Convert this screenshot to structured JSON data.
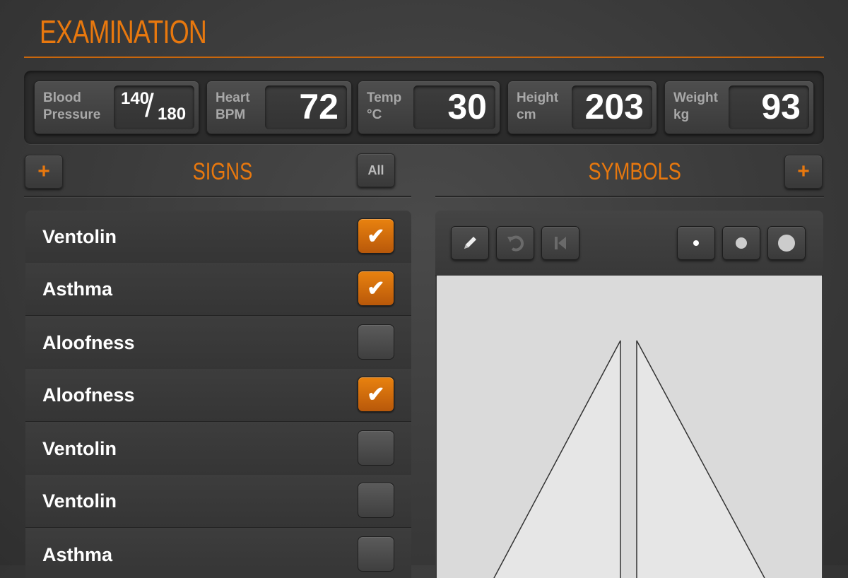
{
  "app": {
    "title": "EXAMINATION"
  },
  "vitals": {
    "blood_pressure": {
      "label": "Blood\nPressure",
      "systolic": "140",
      "separator": "/",
      "diastolic": "180"
    },
    "heart": {
      "label": "Heart\nBPM",
      "value": "72"
    },
    "temp": {
      "label": "Temp\n°C",
      "value": "30"
    },
    "height": {
      "label": "Height\ncm",
      "value": "203"
    },
    "weight": {
      "label": "Weight\nkg",
      "value": "93"
    }
  },
  "signs": {
    "title": "SIGNS",
    "add_label": "+",
    "all_label": "All",
    "items": [
      {
        "label": "Ventolin",
        "checked": true
      },
      {
        "label": "Asthma",
        "checked": true
      },
      {
        "label": "Aloofness",
        "checked": false
      },
      {
        "label": "Aloofness",
        "checked": true
      },
      {
        "label": "Ventolin",
        "checked": false
      },
      {
        "label": "Ventolin",
        "checked": false
      },
      {
        "label": "Asthma",
        "checked": false
      }
    ]
  },
  "symbols": {
    "title": "SYMBOLS",
    "add_label": "+",
    "tools": [
      "pencil-icon",
      "undo-icon",
      "skip-back-icon"
    ],
    "brush_sizes": [
      "small",
      "medium",
      "large"
    ]
  },
  "colors": {
    "accent": "#e8780e",
    "background": "#3b3b3b",
    "canvas": "#dcdcdc"
  }
}
